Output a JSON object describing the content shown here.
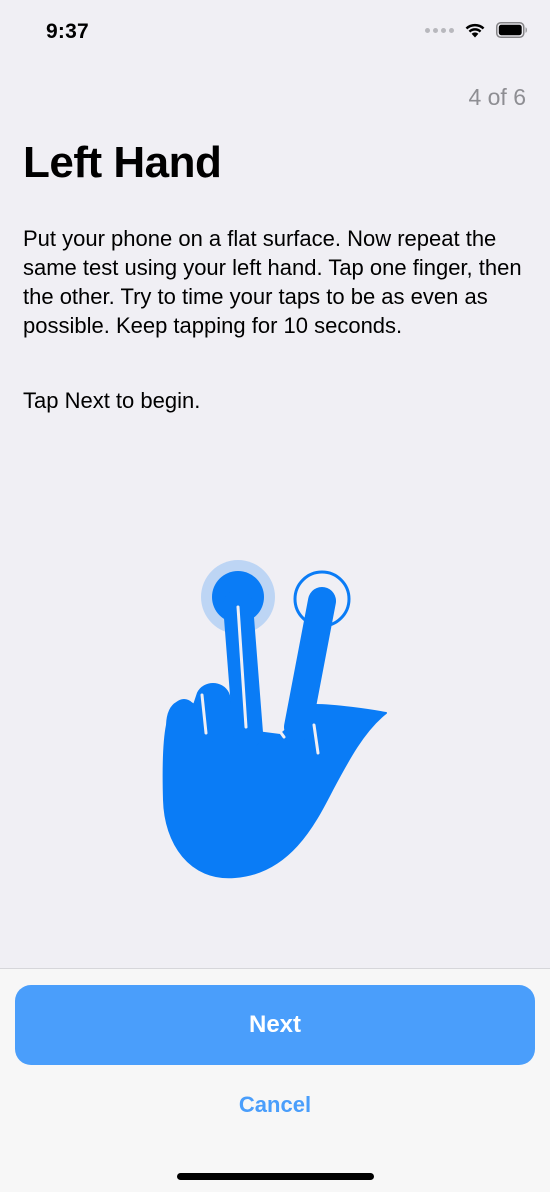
{
  "status_bar": {
    "time": "9:37"
  },
  "header": {
    "step_counter": "4 of 6",
    "title": "Left Hand"
  },
  "content": {
    "instructions": "Put your phone on a flat surface. Now repeat the same test using your left hand. Tap one finger, then the other. Try to time your taps to be as even as possible. Keep tapping for 10 seconds.",
    "prompt": "Tap Next to begin."
  },
  "footer": {
    "next_label": "Next",
    "cancel_label": "Cancel"
  },
  "colors": {
    "accent": "#4a9efb",
    "hand": "#0a7cf6",
    "background": "#f0eff4"
  }
}
